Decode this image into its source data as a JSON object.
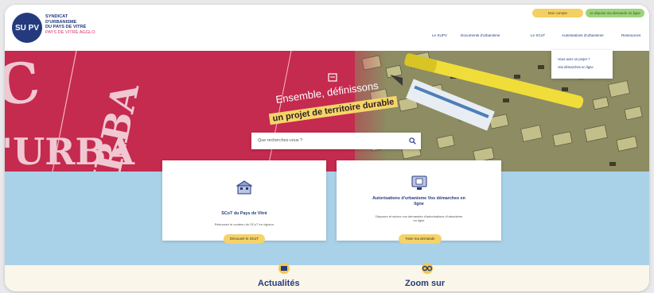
{
  "header": {
    "logo_mark": "SU PV",
    "logo_lines": [
      "SYNDICAT",
      "D'URBANISME",
      "DU PAYS DE VITRÉ"
    ],
    "logo_subline": "PAYS DE VITRÉ AGGLO",
    "pill_yellow": "Mon compte",
    "pill_green": "Je dépose ma demande en ligne",
    "nav": [
      "Le SUPV",
      "Documents d'urbanisme",
      "Le SCoT",
      "Autorisations d'urbanisme",
      "Ressources"
    ],
    "dropdown": [
      "Vous avez un projet ?",
      "Vos démarches en ligne"
    ]
  },
  "hero": {
    "headline_1": "Ensemble, définissons",
    "headline_2": "un projet de territoire durable",
    "search_placeholder": "Que recherchez-vous ?"
  },
  "cards": [
    {
      "title": "SCoT du Pays de Vitré",
      "description": "Retrouvez le contenu du SCoT en vigueur",
      "button": "Découvrir le SCoT"
    },
    {
      "title": "Autorisations d'urbanisme Vos démarches en ligne",
      "description": "Déposez et suivez vos demandes d'autorisations d'urbanisme en ligne",
      "button": "Faire ma demande"
    }
  ],
  "sections": [
    "Actualités",
    "Zoom sur"
  ],
  "colors": {
    "brand_blue": "#243a7c",
    "hero_red": "#c52a4f",
    "accent_yellow": "#f5d26a",
    "band_blue": "#a9d2e9",
    "green": "#9dd37b"
  }
}
